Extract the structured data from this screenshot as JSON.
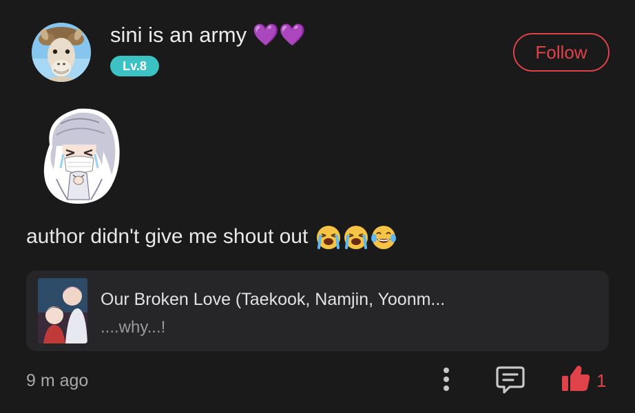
{
  "author": {
    "name": "sini is an army 💜💜",
    "level": "Lv.8",
    "avatar_icon": "alpaca-avatar"
  },
  "follow_button": {
    "label": "Follow",
    "color": "#e0424a"
  },
  "comment": {
    "sticker_icon": "crying-anime-character-sticker",
    "text": "author didn't give me shout out",
    "emojis": [
      "loudly-crying-face-icon",
      "loudly-crying-face-icon",
      "tears-of-joy-face-icon"
    ]
  },
  "story_card": {
    "title": "Our Broken Love (Taekook, Namjin, Yoonm...",
    "excerpt": "....why...!",
    "cover_icon": "story-cover-image"
  },
  "footer": {
    "timestamp": "9 m ago",
    "like_count": "1",
    "icons": {
      "more": "more-vertical-icon",
      "reply": "comment-icon",
      "like": "thumbs-up-icon"
    }
  },
  "colors": {
    "background": "#1a1a1b",
    "accent": "#e0424a",
    "level_badge": "#3cc1c4",
    "card": "#262628"
  }
}
